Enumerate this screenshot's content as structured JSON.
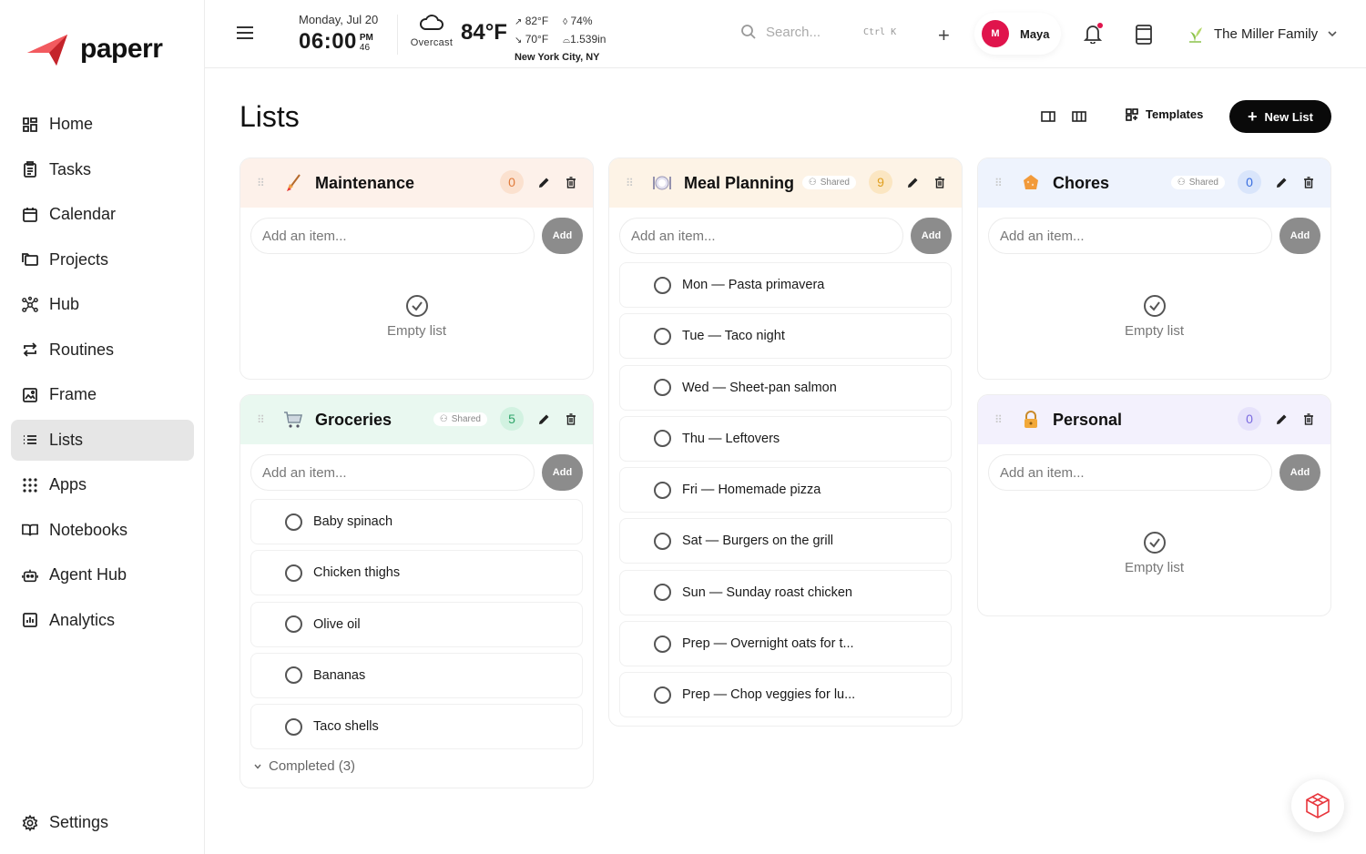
{
  "app": {
    "logo_text": "paperr"
  },
  "sidebar": {
    "items": [
      {
        "label": "Home",
        "icon": "home-grid-icon"
      },
      {
        "label": "Tasks",
        "icon": "clipboard-icon"
      },
      {
        "label": "Calendar",
        "icon": "calendar-icon"
      },
      {
        "label": "Projects",
        "icon": "folder-icon"
      },
      {
        "label": "Hub",
        "icon": "hub-icon"
      },
      {
        "label": "Routines",
        "icon": "repeat-icon"
      },
      {
        "label": "Frame",
        "icon": "frame-icon"
      },
      {
        "label": "Lists",
        "icon": "list-icon",
        "active": true
      },
      {
        "label": "Apps",
        "icon": "apps-icon"
      },
      {
        "label": "Notebooks",
        "icon": "book-icon"
      },
      {
        "label": "Agent Hub",
        "icon": "robot-icon"
      },
      {
        "label": "Analytics",
        "icon": "chart-icon"
      }
    ],
    "settings_label": "Settings"
  },
  "topbar": {
    "date": "Monday, Jul 20",
    "time": "06:00",
    "ampm": "PM",
    "seconds": "46",
    "weather": {
      "condition": "Overcast",
      "temp": "84°F",
      "high": "82°F",
      "low": "70°F",
      "humidity": "74%",
      "pressure": "1.539in",
      "location": "New York City, NY"
    },
    "search_placeholder": "Search...",
    "search_shortcut": "Ctrl K",
    "user": {
      "initial": "M",
      "name": "Maya"
    },
    "family": "The Miller Family"
  },
  "main": {
    "title": "Lists",
    "templates_label": "Templates",
    "new_list_label": "New List"
  },
  "lists": {
    "maintenance": {
      "title": "Maintenance",
      "count": "0",
      "placeholder": "Add an item...",
      "add_label": "Add",
      "empty_label": "Empty list"
    },
    "groceries": {
      "title": "Groceries",
      "shared_label": "Shared",
      "count": "5",
      "placeholder": "Add an item...",
      "add_label": "Add",
      "items": [
        "Baby spinach",
        "Chicken thighs",
        "Olive oil",
        "Bananas",
        "Taco shells"
      ],
      "completed_label": "Completed (3)"
    },
    "meal_planning": {
      "title": "Meal Planning",
      "shared_label": "Shared",
      "count": "9",
      "placeholder": "Add an item...",
      "add_label": "Add",
      "items": [
        "Mon — Pasta primavera",
        "Tue — Taco night",
        "Wed — Sheet-pan salmon",
        "Thu — Leftovers",
        "Fri — Homemade pizza",
        "Sat — Burgers on the grill",
        "Sun — Sunday roast chicken",
        "Prep — Overnight oats for t...",
        "Prep — Chop veggies for lu..."
      ]
    },
    "chores": {
      "title": "Chores",
      "shared_label": "Shared",
      "count": "0",
      "placeholder": "Add an item...",
      "add_label": "Add",
      "empty_label": "Empty list"
    },
    "personal": {
      "title": "Personal",
      "count": "0",
      "placeholder": "Add an item...",
      "add_label": "Add",
      "empty_label": "Empty list"
    }
  },
  "colors": {
    "accent_red": "#e8363d",
    "maintenance_head": "#fdf1ea",
    "groceries_head": "#e9f8f0",
    "meal_head": "#fdf3e6",
    "chores_head": "#eef3fd",
    "personal_head": "#f3f1fd"
  }
}
